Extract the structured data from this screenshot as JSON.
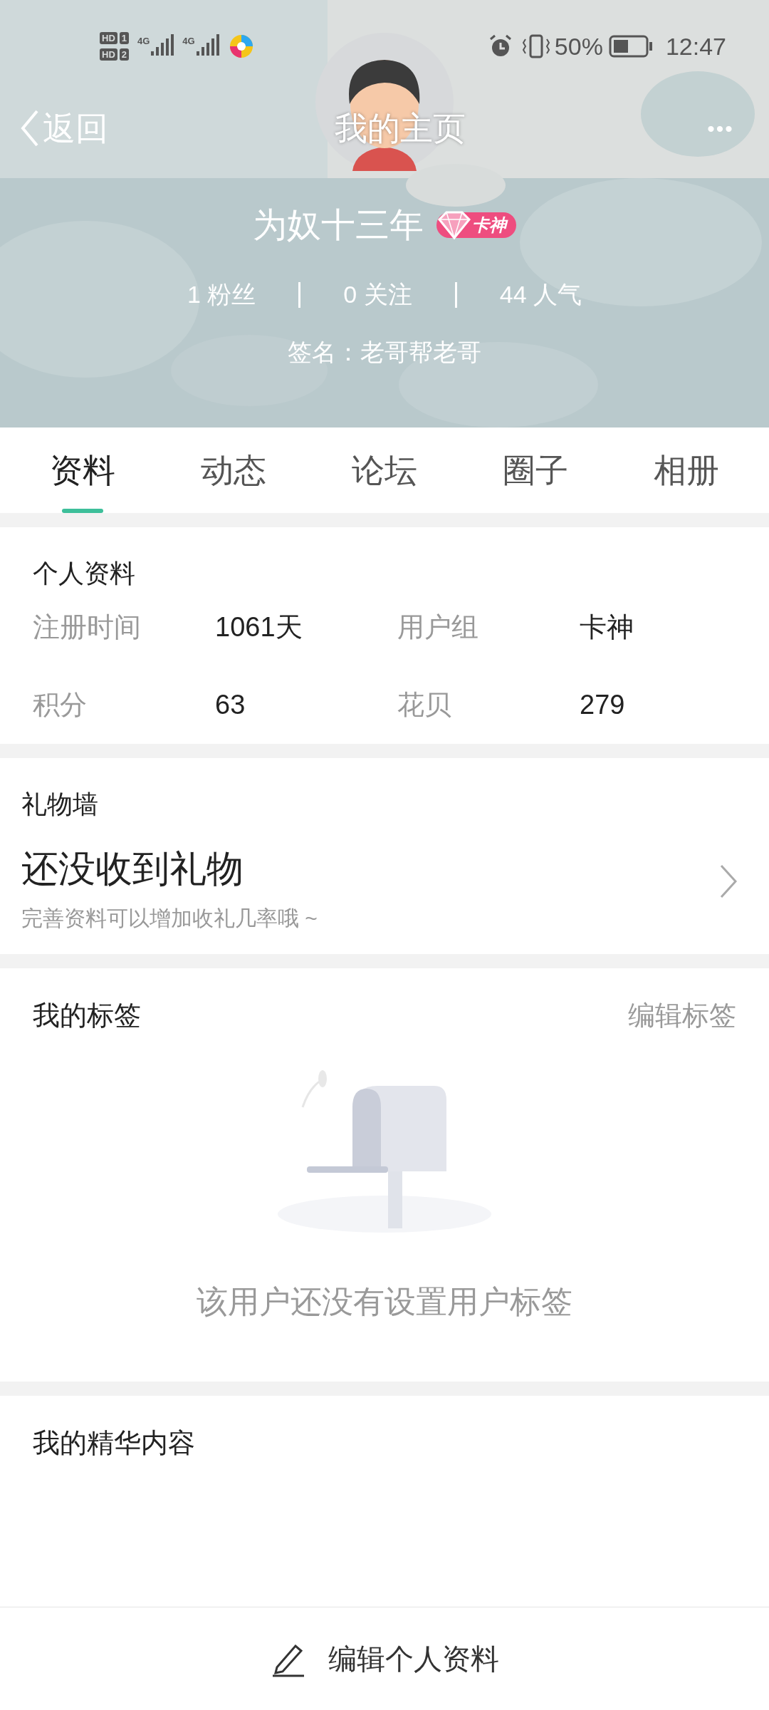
{
  "status_bar": {
    "sim_badges": [
      {
        "label": "HD",
        "slot": "1"
      },
      {
        "label": "HD",
        "slot": "2"
      }
    ],
    "network_labels": [
      "4G",
      "4G"
    ],
    "battery": "50%",
    "time": "12:47"
  },
  "nav": {
    "back": "返回",
    "title": "我的主页",
    "more": "•••"
  },
  "profile": {
    "name": "为奴十三年",
    "badge": "卡神",
    "stats": [
      {
        "count": "1",
        "label": "粉丝"
      },
      {
        "count": "0",
        "label": "关注"
      },
      {
        "count": "44",
        "label": "人气"
      }
    ],
    "signature": "签名：老哥帮老哥"
  },
  "tabs": [
    {
      "label": "资料",
      "selected": true
    },
    {
      "label": "动态",
      "selected": false
    },
    {
      "label": "论坛",
      "selected": false
    },
    {
      "label": "圈子",
      "selected": false
    },
    {
      "label": "相册",
      "selected": false
    }
  ],
  "personal_info": {
    "title": "个人资料",
    "fields": [
      {
        "label": "注册时间",
        "value": "1061天"
      },
      {
        "label": "用户组",
        "value": "卡神"
      },
      {
        "label": "积分",
        "value": "63"
      },
      {
        "label": "花贝",
        "value": "279"
      }
    ]
  },
  "gift_wall": {
    "title": "礼物墙",
    "headline": "还没收到礼物",
    "hint": "完善资料可以增加收礼几率哦 ~"
  },
  "tags": {
    "title": "我的标签",
    "action": "编辑标签",
    "empty_text": "该用户还没有设置用户标签"
  },
  "featured": {
    "title": "我的精华内容"
  },
  "bottom_bar": {
    "button": "编辑个人资料"
  }
}
